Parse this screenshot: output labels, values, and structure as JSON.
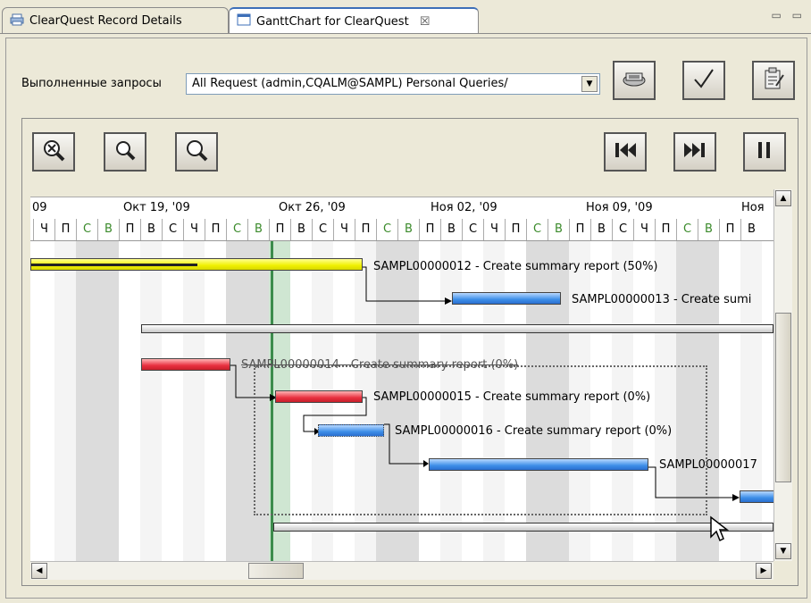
{
  "tabs": [
    {
      "label": "ClearQuest Record Details",
      "icon": "printer-record-icon"
    },
    {
      "label": "GanttChart for ClearQuest",
      "icon": "window-icon",
      "close": "☒"
    }
  ],
  "window_controls": "▭ ▭",
  "query": {
    "label": "Выполненные запросы",
    "selected": "All Request (admin,CQALM@SAMPL) Personal Queries/"
  },
  "toolbar_right": [
    {
      "name": "run-query-icon"
    },
    {
      "name": "checkmark-icon"
    },
    {
      "name": "clipboard-edit-icon"
    }
  ],
  "zoom_buttons": [
    {
      "name": "zoom-reset-icon"
    },
    {
      "name": "zoom-out-icon"
    },
    {
      "name": "zoom-in-icon"
    }
  ],
  "nav_buttons": [
    {
      "name": "first-icon"
    },
    {
      "name": "last-icon"
    },
    {
      "name": "pause-icon"
    }
  ],
  "timeline": {
    "weeks": [
      "09",
      "Окт 19, '09",
      "Окт 26, '09",
      "Ноя 02, '09",
      "Ноя 09, '09",
      "Ноя"
    ],
    "days": [
      "Ч",
      "П",
      "С",
      "В",
      "П",
      "В",
      "С",
      "Ч",
      "П",
      "С",
      "В",
      "П",
      "В",
      "С",
      "Ч",
      "П",
      "С",
      "В",
      "П",
      "В",
      "С",
      "Ч",
      "П",
      "С",
      "В",
      "П",
      "В",
      "С",
      "Ч",
      "П",
      "С",
      "В",
      "П",
      "В"
    ]
  },
  "tasks": [
    {
      "id": "t12",
      "label": "SAMPL00000012 - Create summary report (50%)",
      "color": "yellow"
    },
    {
      "id": "t13",
      "label": "SAMPL00000013 - Create sumi",
      "color": "blue"
    },
    {
      "id": "t14",
      "label": "SAMPL00000014 - Create summary report (0%)",
      "color": "red"
    },
    {
      "id": "t15",
      "label": "SAMPL00000015 - Create summary report (0%)",
      "color": "red"
    },
    {
      "id": "t16",
      "label": "SAMPL00000016 - Create summary report (0%)",
      "color": "blue"
    },
    {
      "id": "t17",
      "label": "SAMPL00000017",
      "color": "blue"
    }
  ],
  "colors": {
    "today": "#3c8c4c",
    "blue": "#3d8ee8",
    "red": "#e83040",
    "yellow": "#f0f000"
  }
}
